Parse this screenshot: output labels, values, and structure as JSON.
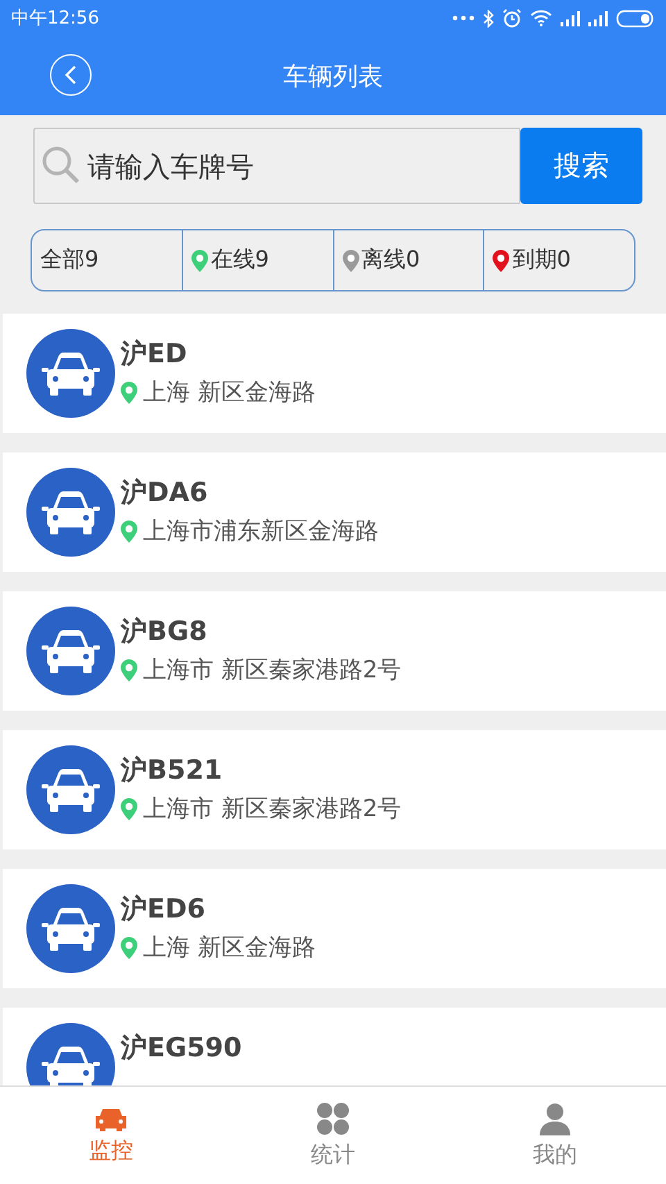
{
  "status_bar": {
    "time": "中午12:56"
  },
  "header": {
    "title": "车辆列表"
  },
  "search": {
    "placeholder": "请输入车牌号",
    "button": "搜索"
  },
  "filters": [
    {
      "label": "全部9",
      "selected": false
    },
    {
      "label": "在线9",
      "selected": false,
      "color": "#3ecf7a"
    },
    {
      "label": "离线0",
      "selected": false,
      "color": "#9a9a9a"
    },
    {
      "label": "到期0",
      "selected": false,
      "color": "#e3101e"
    }
  ],
  "vehicles": [
    {
      "plate": "沪ED",
      "address": "上海 新区金海路"
    },
    {
      "plate": "沪DA6",
      "address": "上海市浦东新区金海路"
    },
    {
      "plate": "沪BG8",
      "address": "上海市 新区秦家港路2号"
    },
    {
      "plate": "沪B521",
      "address": "上海市 新区秦家港路2号"
    },
    {
      "plate": "沪ED6",
      "address": "上海 新区金海路"
    },
    {
      "plate": "沪EG590"
    }
  ],
  "tabs": [
    {
      "label": "监控",
      "selected": true,
      "kind": "car"
    },
    {
      "label": "统计",
      "selected": false,
      "kind": "grid"
    },
    {
      "label": "我的",
      "selected": false,
      "kind": "person"
    }
  ]
}
